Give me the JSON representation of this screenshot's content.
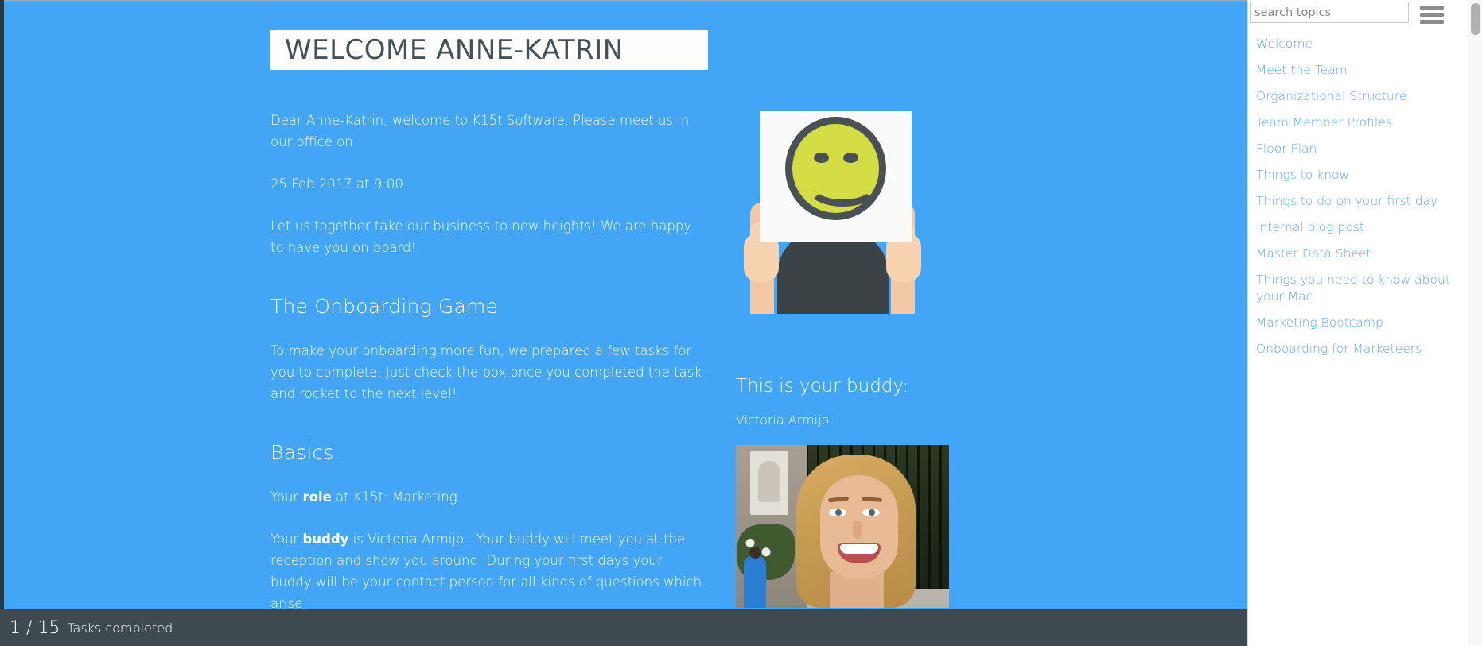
{
  "page": {
    "title": "WELCOME ANNE-KATRIN"
  },
  "intro": {
    "greeting_part1": "Dear Anne-Katrin, welcome to K15t Software. Please meet us in our office on",
    "date_line": "25 Feb 2017  at 9:00.",
    "closing": "Let us together take our business to new heights! We are happy to have you on board!"
  },
  "onboarding": {
    "heading": "The Onboarding Game",
    "body": "To make your onboarding more fun, we prepared a few tasks for you to complete. Just check the box once you completed the task and rocket to the next level!"
  },
  "basics": {
    "heading": "Basics",
    "role_prefix": "Your ",
    "role_bold": "role",
    "role_suffix": " at K15t: Marketing",
    "buddy_prefix": "Your ",
    "buddy_bold": "buddy",
    "buddy_suffix": " is Victoria Armijo . Your buddy will meet you at the reception and show you around. During your first days your buddy will be your contact person for all kinds of questions which arise"
  },
  "buddy": {
    "heading": "This is your buddy:",
    "name": "Victoria Armijo",
    "photo_alt": "buddy-photo"
  },
  "media": {
    "welcome_image_alt": "person-holding-smiley-sign"
  },
  "status": {
    "count": "1 / 15",
    "label": "Tasks completed"
  },
  "sidebar": {
    "search_placeholder": "search topics",
    "search_value": "",
    "menu_icon": "hamburger-icon",
    "items": [
      {
        "label": "Welcome"
      },
      {
        "label": "Meet the Team"
      },
      {
        "label": "Organizational Structure"
      },
      {
        "label": "Team Member Profiles"
      },
      {
        "label": "Floor Plan"
      },
      {
        "label": "Things to know"
      },
      {
        "label": "Things to do on your first day"
      },
      {
        "label": "Internal blog post"
      },
      {
        "label": "Master Data Sheet"
      },
      {
        "label": "Things you need to know about your Mac"
      },
      {
        "label": "Marketing Bootcamp"
      },
      {
        "label": "Onboarding for Marketeers"
      }
    ]
  },
  "colors": {
    "background_blue": "#42a5f5",
    "link_blue": "#5aaaf5",
    "statusbar_dark": "#3e4a50",
    "title_text": "#42515a",
    "smiley_yellow": "#d4dd43"
  }
}
